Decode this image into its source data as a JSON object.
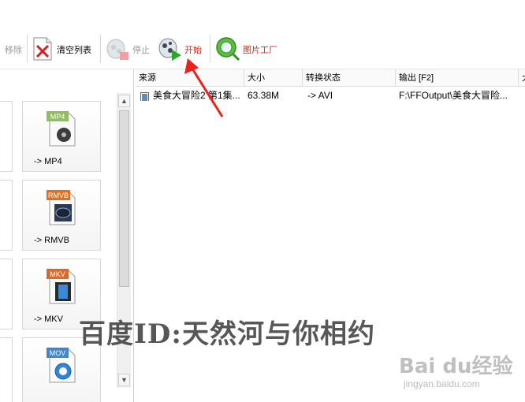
{
  "toolbar": {
    "remove_label": "移除",
    "clear_list_label": "清空列表",
    "stop_label": "停止",
    "start_label": "开始",
    "picture_factory_label": "图片工厂"
  },
  "formats": [
    {
      "badge": "MP4",
      "label": "-> MP4",
      "badge_color": "#8fbf5a"
    },
    {
      "badge": "RMVB",
      "label": "-> RMVB",
      "badge_color": "#e0701e"
    },
    {
      "badge": "MKV",
      "label": "-> MKV",
      "badge_color": "#d96a2b"
    },
    {
      "badge": "MOV",
      "label": "",
      "badge_color": "#3f87c9"
    }
  ],
  "table": {
    "headers": [
      "来源",
      "大小",
      "转换状态",
      "输出 [F2]",
      "大"
    ],
    "rows": [
      {
        "source": "美食大冒险2 第1集...",
        "size": "63.38M",
        "status": "-> AVI",
        "output": "F:\\FFOutput\\美食大冒险..."
      }
    ]
  },
  "watermark": {
    "text": "百度ID:天然河与你相约",
    "baidu_logo": "Bai du经验",
    "baidu_url": "jingyan.baidu.com"
  },
  "colors": {
    "start_label": "#d22b1a",
    "picture_factory_label": "#d22b1a",
    "arrow": "#e8231d"
  }
}
